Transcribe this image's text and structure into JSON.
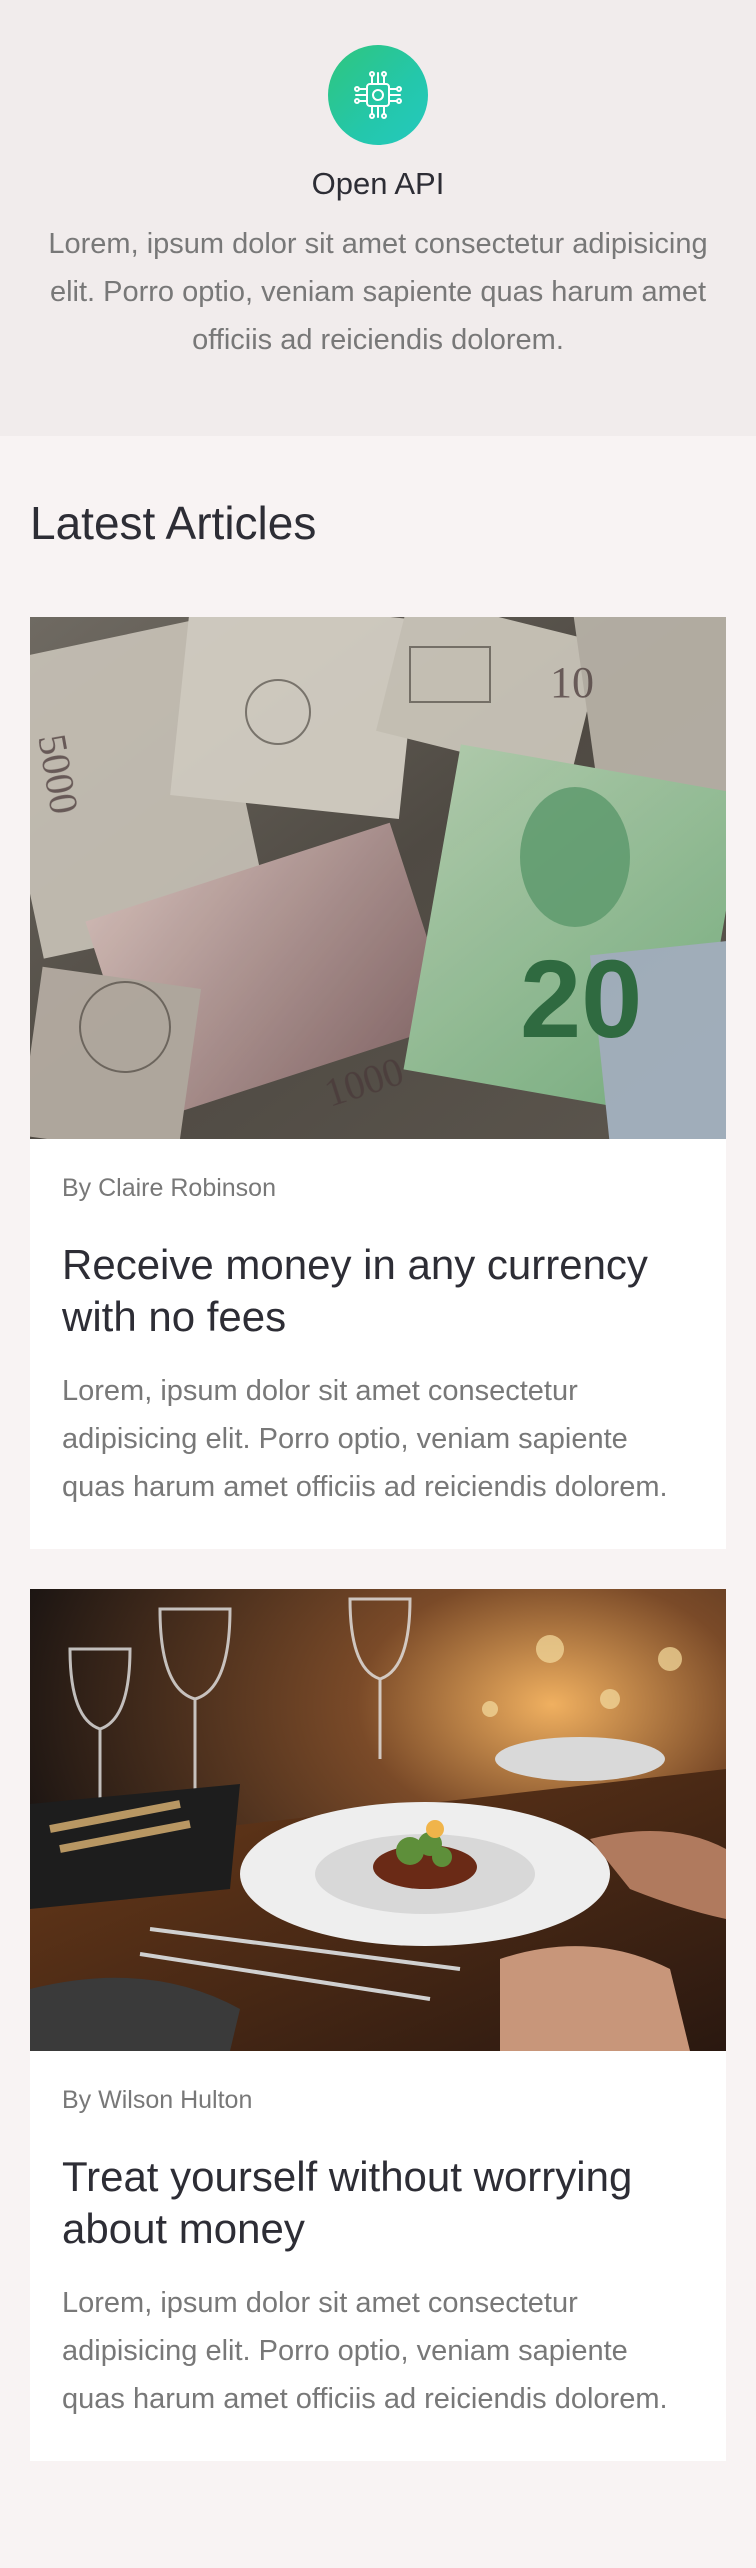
{
  "hero": {
    "icon": "circuit-chip-icon",
    "title": "Open API",
    "description": "Lorem, ipsum dolor sit amet consectetur adipisicing elit. Porro optio, veniam sapiente quas harum amet officiis ad reiciendis dolorem."
  },
  "main": {
    "section_title": "Latest Articles",
    "articles": [
      {
        "image": "currency-banknotes-photo",
        "author": "By Claire Robinson",
        "title": "Receive money in any currency with no fees",
        "description": "Lorem, ipsum dolor sit amet consectetur adipisicing elit. Porro optio, veniam sapiente quas harum amet officiis ad reiciendis dolorem."
      },
      {
        "image": "restaurant-dinner-table-photo",
        "author": "By Wilson Hulton",
        "title": "Treat yourself without worrying about money",
        "description": "Lorem, ipsum dolor sit amet consectetur adipisicing elit. Porro optio, veniam sapiente quas harum amet officiis ad reiciendis dolorem."
      }
    ]
  },
  "colors": {
    "hero_bg": "#f1ecec",
    "page_bg": "#f8f3f3",
    "accent_gradient_start": "#2fc57d",
    "accent_gradient_end": "#25c9bf",
    "text_dark": "#2d2d35",
    "text_muted": "#787878"
  }
}
